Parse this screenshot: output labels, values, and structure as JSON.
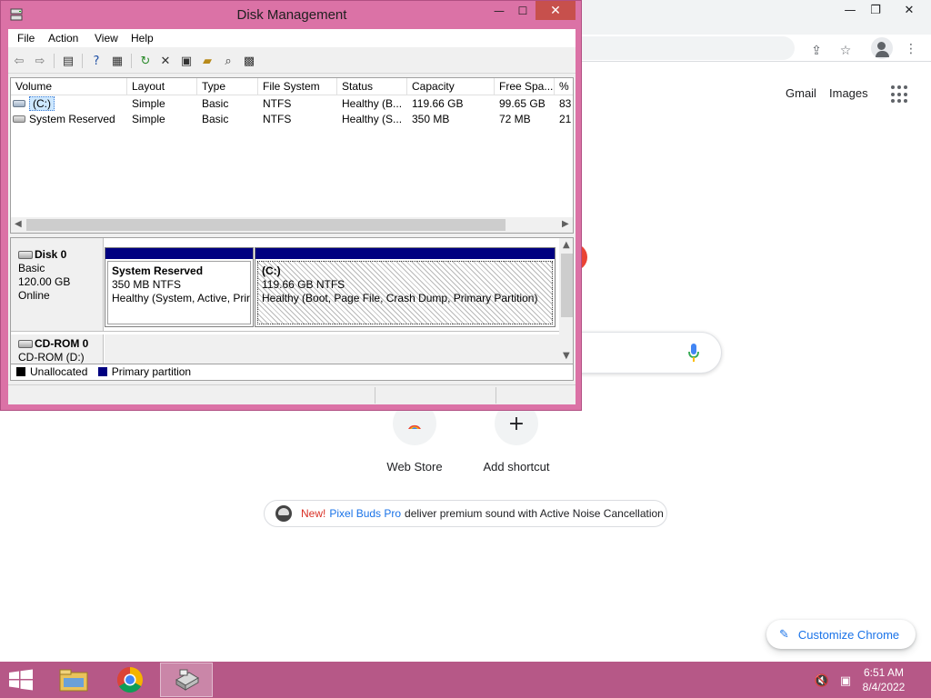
{
  "chrome": {
    "top_links": [
      "Gmail",
      "Images"
    ],
    "shortcuts": [
      {
        "label": "Web Store",
        "icon": "chrome-web-store-icon"
      },
      {
        "label": "Add shortcut",
        "icon": "plus-icon"
      }
    ],
    "promo": {
      "new_label": "New!",
      "product": "Pixel Buds Pro",
      "text": "deliver premium sound with Active Noise Cancellation"
    },
    "customize_label": "Customize Chrome",
    "colors": {
      "accent": "#1a73e8",
      "promo_new": "#d93025"
    }
  },
  "disk_management": {
    "title": "Disk Management",
    "menu": [
      "File",
      "Action",
      "View",
      "Help"
    ],
    "columns": [
      "Volume",
      "Layout",
      "Type",
      "File System",
      "Status",
      "Capacity",
      "Free Spa...",
      "% F"
    ],
    "volumes": [
      {
        "volume": "(C:)",
        "layout": "Simple",
        "type": "Basic",
        "fs": "NTFS",
        "status": "Healthy (B...",
        "capacity": "119.66 GB",
        "free": "99.65 GB",
        "pct": "83"
      },
      {
        "volume": "System Reserved",
        "layout": "Simple",
        "type": "Basic",
        "fs": "NTFS",
        "status": "Healthy (S...",
        "capacity": "350 MB",
        "free": "72 MB",
        "pct": "21"
      }
    ],
    "disks": [
      {
        "name": "Disk 0",
        "kind": "Basic",
        "size": "120.00 GB",
        "state": "Online",
        "partitions": [
          {
            "name": "System Reserved",
            "size": "350 MB NTFS",
            "status": "Healthy (System, Active, Prir"
          },
          {
            "name": "(C:)",
            "size": "119.66 GB NTFS",
            "status": "Healthy (Boot, Page File, Crash Dump, Primary Partition)"
          }
        ]
      },
      {
        "name": "CD-ROM 0",
        "kind": "CD-ROM (D:)"
      }
    ],
    "legend": [
      {
        "label": "Unallocated",
        "color": "#000000"
      },
      {
        "label": "Primary partition",
        "color": "#000080"
      }
    ],
    "colors": {
      "window_frame": "#db72a6",
      "close_button": "#c7504c",
      "partition_bar": "#000080",
      "selection": "#cde8ff"
    }
  },
  "taskbar": {
    "time": "6:51 AM",
    "date": "8/4/2022",
    "apps": [
      "file-explorer",
      "google-chrome",
      "disk-management"
    ],
    "color": "#b65887"
  }
}
